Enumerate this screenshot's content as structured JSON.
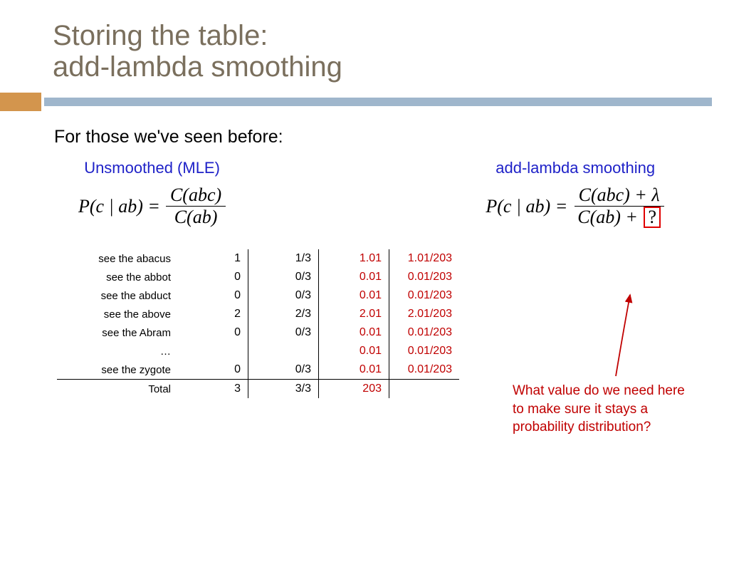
{
  "title_line1": "Storing the table:",
  "title_line2": "add-lambda smoothing",
  "subtitle": "For those we've seen before:",
  "left_header": "Unsmoothed (MLE)",
  "right_header": "add-lambda smoothing",
  "formula_lhs": "P(c | ab) =",
  "left_num": "C(abc)",
  "left_den": "C(ab)",
  "right_num_a": "C(abc) + ",
  "right_num_lambda": "λ",
  "right_den_a": "C(ab) + ",
  "right_den_q": "?",
  "callout": "What value do we need here to make sure it stays a probability distribution?",
  "chart_data": {
    "type": "table",
    "columns": [
      "phrase",
      "count",
      "mle",
      "add_lambda_count",
      "add_lambda_prob"
    ],
    "rows": [
      {
        "phrase": "see the abacus",
        "count": "1",
        "mle": "1/3",
        "al_count": "1.01",
        "al_prob": "1.01/203"
      },
      {
        "phrase": "see the abbot",
        "count": "0",
        "mle": "0/3",
        "al_count": "0.01",
        "al_prob": "0.01/203"
      },
      {
        "phrase": "see the abduct",
        "count": "0",
        "mle": "0/3",
        "al_count": "0.01",
        "al_prob": "0.01/203"
      },
      {
        "phrase": "see the above",
        "count": "2",
        "mle": "2/3",
        "al_count": "2.01",
        "al_prob": "2.01/203"
      },
      {
        "phrase": "see the Abram",
        "count": "0",
        "mle": "0/3",
        "al_count": "0.01",
        "al_prob": "0.01/203"
      },
      {
        "phrase": "…",
        "count": "",
        "mle": "",
        "al_count": "0.01",
        "al_prob": "0.01/203"
      },
      {
        "phrase": "see the zygote",
        "count": "0",
        "mle": "0/3",
        "al_count": "0.01",
        "al_prob": "0.01/203"
      }
    ],
    "total": {
      "phrase": "Total",
      "count": "3",
      "mle": "3/3",
      "al_count": "203",
      "al_prob": ""
    }
  }
}
